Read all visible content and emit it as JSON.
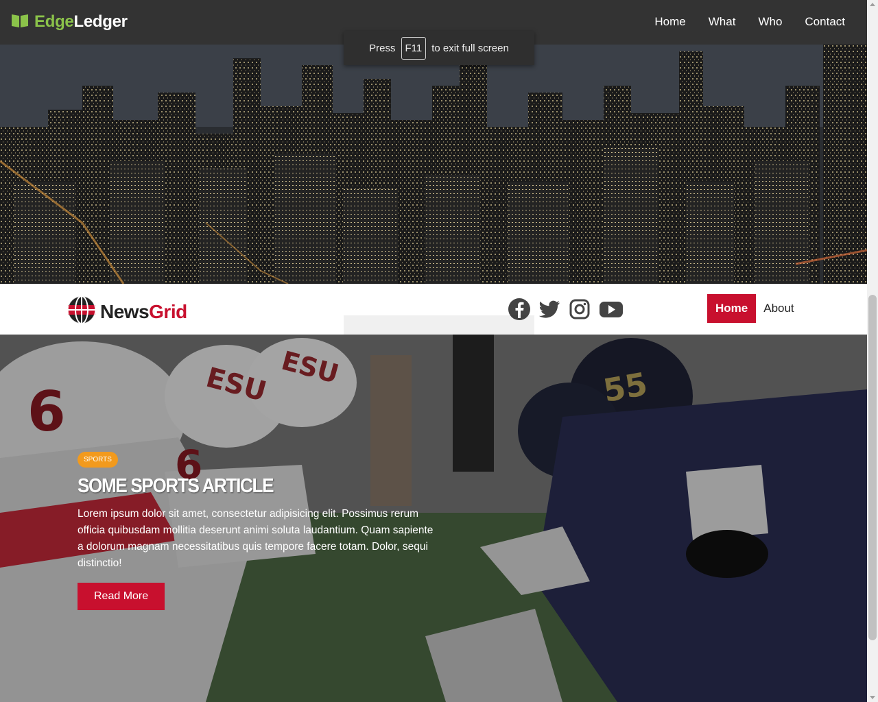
{
  "header": {
    "brand_part1": "Edge",
    "brand_part2": "Ledger",
    "brand_icon": "open-book-icon",
    "nav": [
      "Home",
      "What",
      "Who",
      "Contact"
    ]
  },
  "fullscreen_toast": {
    "prefix": "Press",
    "key": "F11",
    "suffix": "to exit full screen"
  },
  "newsgrid": {
    "logo_part1": "News",
    "logo_part2": "Grid",
    "logo_icon": "globe-icon",
    "social_icons": [
      "facebook-icon",
      "twitter-icon",
      "instagram-icon",
      "youtube-icon"
    ],
    "nav": {
      "home": "Home",
      "about": "About"
    }
  },
  "featured": {
    "category": "SPORTS",
    "title": "SOME SPORTS ARTICLE",
    "body": "Lorem ipsum dolor sit amet, consectetur adipisicing elit. Possimus rerum officia quibusdam mollitia deserunt animi soluta laudantium. Quam sapiente a dolorum magnam necessitatibus quis tempore facere totam. Dolor, sequi distinctio!",
    "cta": "Read More",
    "jersey_numbers": [
      "6",
      "6",
      "55"
    ],
    "helmet_text": "ESU"
  },
  "colors": {
    "header_bg": "#333333",
    "brand_green": "#8bc34a",
    "accent_red": "#c8102e",
    "tag_orange": "#f29a1d"
  }
}
